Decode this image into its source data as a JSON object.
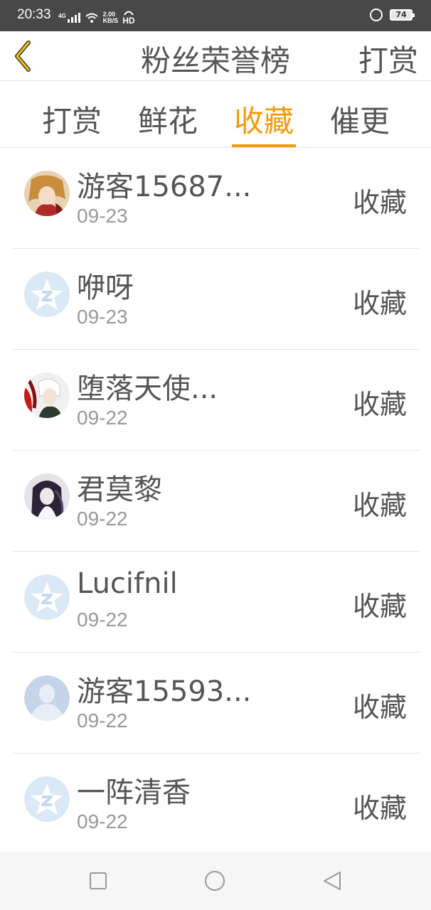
{
  "status": {
    "time": "20:33",
    "network": "4G",
    "speed_value": "2.00",
    "speed_unit": "KB/S",
    "hd": "HD",
    "battery": "74"
  },
  "header": {
    "title": "粉丝荣誉榜",
    "action": "打赏"
  },
  "tabs": [
    {
      "label": "打赏",
      "active": false
    },
    {
      "label": "鲜花",
      "active": false
    },
    {
      "label": "收藏",
      "active": true
    },
    {
      "label": "催更",
      "active": false
    }
  ],
  "accent_color": "#f29b0f",
  "list": [
    {
      "name": "游客15687...",
      "date": "09-23",
      "type": "收藏",
      "avatar": "anime-avatar-red"
    },
    {
      "name": "咿呀",
      "date": "09-23",
      "type": "收藏",
      "avatar": "default-star-avatar"
    },
    {
      "name": "堕落天使...",
      "date": "09-22",
      "type": "收藏",
      "avatar": "anime-avatar-white-hair"
    },
    {
      "name": "君莫黎",
      "date": "09-22",
      "type": "收藏",
      "avatar": "anime-avatar-dark"
    },
    {
      "name": "Lucifnil",
      "date": "09-22",
      "type": "收藏",
      "avatar": "default-star-avatar"
    },
    {
      "name": "游客15593...",
      "date": "09-22",
      "type": "收藏",
      "avatar": "default-user-avatar"
    },
    {
      "name": "一阵清香",
      "date": "09-22",
      "type": "收藏",
      "avatar": "default-star-avatar"
    }
  ],
  "system_nav": {
    "buttons": [
      "recent-apps",
      "home",
      "back"
    ]
  }
}
